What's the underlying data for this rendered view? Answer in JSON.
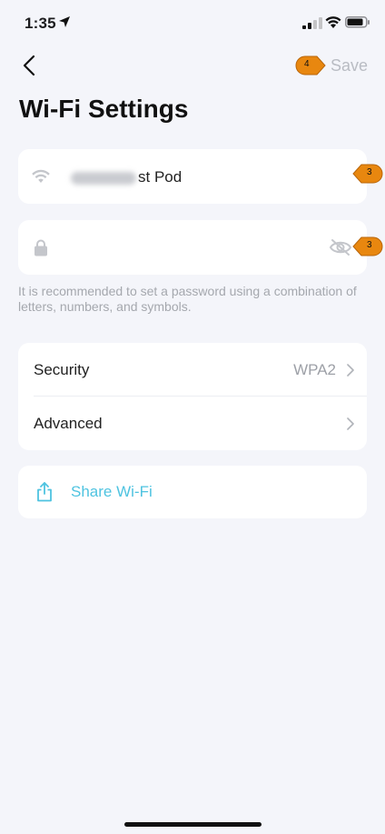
{
  "status_bar": {
    "time": "1:35"
  },
  "nav": {
    "save_label": "Save",
    "save_badge": "4"
  },
  "page": {
    "title": "Wi-Fi Settings"
  },
  "ssid_field": {
    "value_suffix": "st Pod",
    "badge": "3"
  },
  "password_field": {
    "badge": "3"
  },
  "hint": "It is recommended to set a password using a combination of letters, numbers, and symbols.",
  "settings": {
    "security_label": "Security",
    "security_value": "WPA2",
    "advanced_label": "Advanced"
  },
  "share": {
    "label": "Share Wi-Fi"
  },
  "colors": {
    "background": "#f4f5fa",
    "accent": "#4ec3e0",
    "badge": "#e8870f",
    "muted": "#b9bcc3"
  }
}
